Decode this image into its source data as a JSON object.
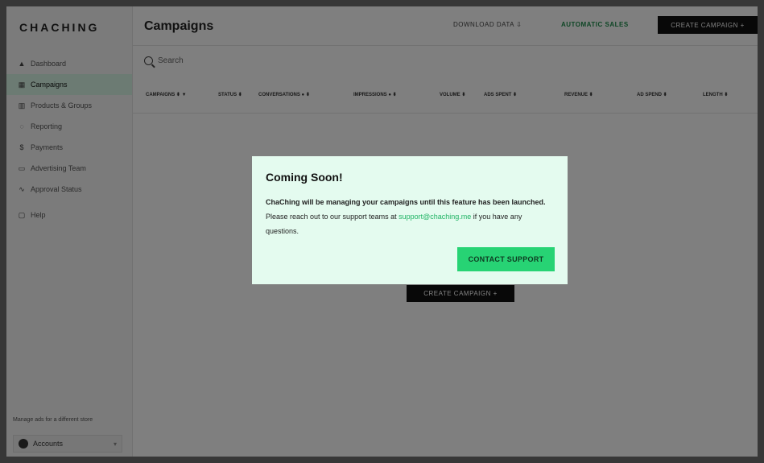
{
  "app": {
    "logo": "CHACHING"
  },
  "sidebar": {
    "items": [
      {
        "label": "Dashboard",
        "icon": "dashboard-icon",
        "glyph": "▲"
      },
      {
        "label": "Campaigns",
        "icon": "campaigns-icon",
        "glyph": "▦"
      },
      {
        "label": "Products & Groups",
        "icon": "products-icon",
        "glyph": "▥"
      },
      {
        "label": "Reporting",
        "icon": "reporting-icon",
        "glyph": "◌"
      },
      {
        "label": "Payments",
        "icon": "payments-icon",
        "glyph": "$"
      },
      {
        "label": "Advertising Team",
        "icon": "team-icon",
        "glyph": "▭"
      },
      {
        "label": "Approval Status",
        "icon": "approval-icon",
        "glyph": "∿"
      }
    ],
    "active_index": 1,
    "help": {
      "label": "Help",
      "icon": "help-icon",
      "glyph": "▢"
    },
    "footer_text": "Manage ads for a different store",
    "account": {
      "label": "Accounts",
      "chevron": "▾"
    }
  },
  "header": {
    "title": "Campaigns",
    "download_label": "DOWNLOAD DATA ⇩",
    "automatic_sales_label": "AUTOMATIC SALES",
    "create_label": "CREATE CAMPAIGN +"
  },
  "search": {
    "placeholder": "Search"
  },
  "table": {
    "columns": [
      "CAMPAIGNS ⬍ ▼",
      "STATUS ⬍",
      "CONVERSATIONS ● ⬍",
      "IMPRESSIONS ● ⬍",
      "VOLUME ⬍",
      "ADS SPENT ⬍",
      "REVENUE ⬍",
      "AD SPEND ⬍",
      "LENGTH ⬍"
    ]
  },
  "empty_state": {
    "create_label": "CREATE CAMPAIGN +"
  },
  "modal": {
    "title": "Coming Soon!",
    "body_bold": "ChaChing will be managing your campaigns until this feature has been launched.",
    "body_text": " Please reach out to our support teams at ",
    "email": "support@chaching.me",
    "body_end": " if you have any questions.",
    "button_label": "CONTACT SUPPORT"
  },
  "colors": {
    "accent": "#27d374",
    "modal_bg": "#e4fbef",
    "active_nav": "#d8f7e6"
  }
}
